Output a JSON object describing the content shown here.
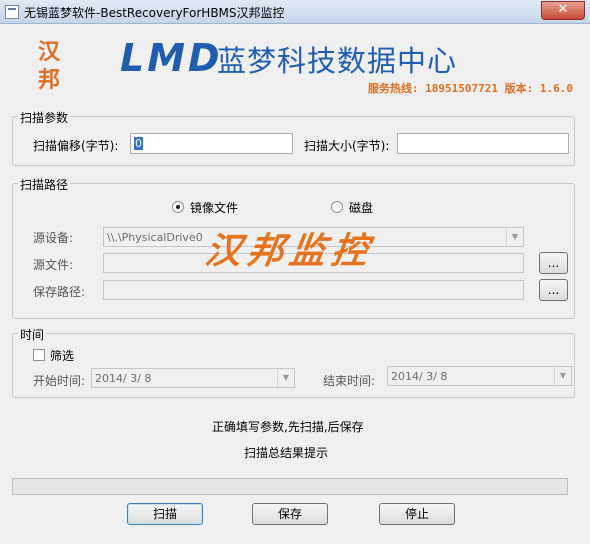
{
  "window": {
    "title": "无锡蓝梦软件-BestRecoveryForHBMS汉邦监控",
    "close_glyph": "✕"
  },
  "banner": {
    "logo_char_1": "汉",
    "logo_char_2": "邦",
    "brand": "LMD",
    "center_name": "蓝梦科技数据中心",
    "hotline": "服务热线: 18951507721 版本: 1.6.0",
    "brand_color": "#1f5fb0",
    "accent_color": "#e07020"
  },
  "scan_params": {
    "group_label": "扫描参数",
    "offset_label": "扫描偏移(字节):",
    "offset_value": "0",
    "size_label": "扫描大小(字节):",
    "size_value": ""
  },
  "scan_path": {
    "group_label": "扫描路径",
    "radio_image": "镜像文件",
    "radio_disk": "磁盘",
    "selected": "镜像文件",
    "device_label": "源设备:",
    "device_value": "\\\\.\\PhysicalDrive0",
    "file_label": "源文件:",
    "file_value": "",
    "file_browse": "...",
    "save_label": "保存路径:",
    "save_value": "",
    "save_browse": "..."
  },
  "watermark": "汉邦监控",
  "time": {
    "group_label": "时间",
    "filter_label": "筛选",
    "filter_checked": false,
    "start_label": "开始时间:",
    "start_value": "2014/ 3/ 8",
    "end_label": "结束时间:",
    "end_value": "2014/ 3/ 8"
  },
  "messages": {
    "instruction": "正确填写参数,先扫描,后保存",
    "result_hint": "扫描总结果提示"
  },
  "progress": {
    "fraction": 0
  },
  "buttons": {
    "scan": "扫描",
    "save": "保存",
    "stop": "停止"
  }
}
